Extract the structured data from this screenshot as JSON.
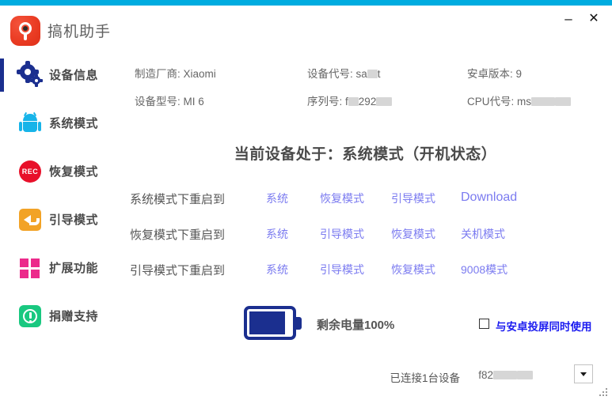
{
  "window": {
    "title": "搞机助手",
    "accent_color": "#00ace0",
    "minimize_label": "–",
    "close_label": "✕"
  },
  "sidebar": {
    "active_index": 0,
    "items": [
      {
        "label": "设备信息",
        "icon": "gear-icon",
        "color": "#1b2f8f"
      },
      {
        "label": "系统模式",
        "icon": "android-icon",
        "color": "#17b4e9"
      },
      {
        "label": "恢复模式",
        "icon": "rec-icon",
        "icon_text": "REC",
        "color": "#e8102a"
      },
      {
        "label": "引导模式",
        "icon": "back-arrow-icon",
        "color": "#f2a327"
      },
      {
        "label": "扩展功能",
        "icon": "grid-icon",
        "color": "#ec2a8b"
      },
      {
        "label": "捐赠支持",
        "icon": "exclamation-circle-icon",
        "color": "#19c880"
      }
    ]
  },
  "device_info": [
    {
      "label": "制造厂商:",
      "value": "Xiaomi",
      "redacted": false
    },
    {
      "label": "设备代号:",
      "value": "sa",
      "value_suffix": "t",
      "redacted": true
    },
    {
      "label": "安卓版本:",
      "value": "9",
      "redacted": false
    },
    {
      "label": "设备型号:",
      "value": "MI 6",
      "redacted": false
    },
    {
      "label": "序列号:",
      "value": "f",
      "value_mid": "292",
      "redacted": true
    },
    {
      "label": "CPU代号:",
      "value": "ms",
      "redacted": true
    }
  ],
  "status_heading": "当前设备处于：系统模式（开机状态）",
  "mode_rows": [
    {
      "label": "系统模式下重启到",
      "links": [
        "系统",
        "恢复模式",
        "引导模式",
        "Download"
      ]
    },
    {
      "label": "恢复模式下重启到",
      "links": [
        "系统",
        "引导模式",
        "恢复模式",
        "关机模式"
      ]
    },
    {
      "label": "引导模式下重启到",
      "links": [
        "系统",
        "引导模式",
        "恢复模式",
        "9008模式"
      ]
    }
  ],
  "battery": {
    "text": "剩余电量100%",
    "percent": 100,
    "color": "#1b2f8f"
  },
  "checkbox": {
    "label": "与安卓投屏同时使用",
    "checked": false,
    "color": "#1b1bf0"
  },
  "statusbar": {
    "connected_text": "已连接1台设备",
    "device_id": "f82",
    "dropdown_icon": "chevron-down-icon"
  }
}
